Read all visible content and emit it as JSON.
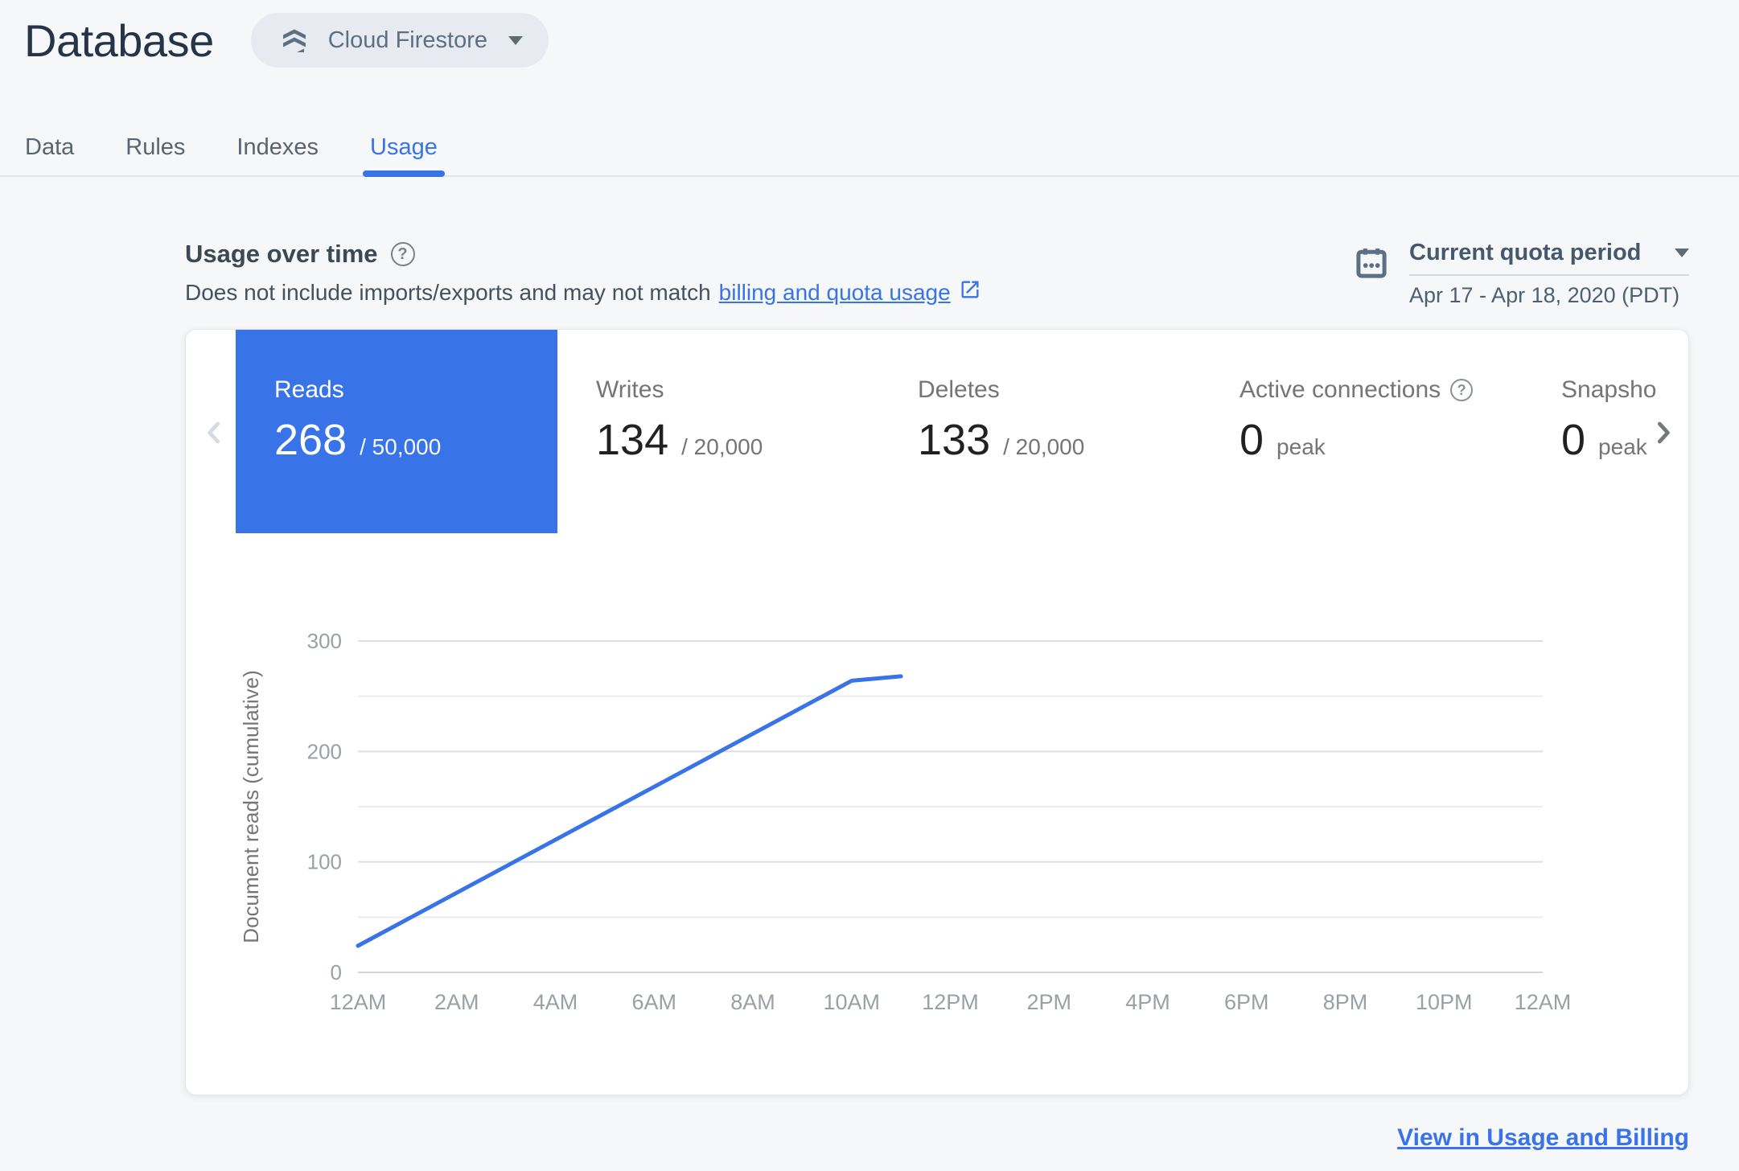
{
  "colors": {
    "accent_blue": "#3973e8",
    "selected_tile_bg": "#3973e8",
    "chart_line_blue": "#3973e8",
    "page_bg": "#f6f7f9",
    "title_navy": "#253448"
  },
  "header": {
    "title": "Database",
    "database_selector": {
      "label": "Cloud Firestore",
      "icon": "firestore-icon",
      "caret": "chevron-down-icon"
    }
  },
  "tabs": [
    {
      "label": "Data",
      "active": false
    },
    {
      "label": "Rules",
      "active": false
    },
    {
      "label": "Indexes",
      "active": false
    },
    {
      "label": "Usage",
      "active": true
    }
  ],
  "usage_section": {
    "title": "Usage over time",
    "help_icon": "help-circle-icon",
    "description_prefix": "Does not include imports/exports and may not match",
    "description_link": "billing and quota usage",
    "external_link_icon": "open-in-new-icon",
    "period_selector": {
      "calendar_icon": "calendar-icon",
      "label": "Current quota period",
      "value": "Apr 17 - Apr 18, 2020 (PDT)"
    }
  },
  "metrics": [
    {
      "id": "reads",
      "label": "Reads",
      "value": "268",
      "suffix": "/ 50,000",
      "selected": true,
      "help": false
    },
    {
      "id": "writes",
      "label": "Writes",
      "value": "134",
      "suffix": "/ 20,000",
      "selected": false,
      "help": false
    },
    {
      "id": "deletes",
      "label": "Deletes",
      "value": "133",
      "suffix": "/ 20,000",
      "selected": false,
      "help": false
    },
    {
      "id": "active-connections",
      "label": "Active connections",
      "value": "0",
      "suffix": "peak",
      "selected": false,
      "help": true
    },
    {
      "id": "snapshot-listeners",
      "label": "Snapsho",
      "value": "0",
      "suffix": "peak",
      "selected": false,
      "help": false
    }
  ],
  "carousel": {
    "prev_enabled": false,
    "next_enabled": true
  },
  "chart_data": {
    "type": "line",
    "title": "",
    "xlabel": "",
    "ylabel": "Document reads (cumulative)",
    "ylim": [
      0,
      300
    ],
    "y_ticks": [
      0,
      100,
      200,
      300
    ],
    "y_minor_step": 50,
    "grid": "horizontal",
    "legend": "none",
    "x_tick_labels": [
      "12AM",
      "2AM",
      "4AM",
      "6AM",
      "8AM",
      "10AM",
      "12PM",
      "2PM",
      "4PM",
      "6PM",
      "8PM",
      "10PM",
      "12AM"
    ],
    "x_hours_span": 24,
    "series": [
      {
        "name": "Document reads (cumulative)",
        "color": "#3973e8",
        "points": [
          {
            "hour": 0,
            "value": 24
          },
          {
            "hour": 10,
            "value": 264
          },
          {
            "hour": 11,
            "value": 268
          }
        ]
      }
    ]
  },
  "footer": {
    "link_label": "View in Usage and Billing"
  }
}
